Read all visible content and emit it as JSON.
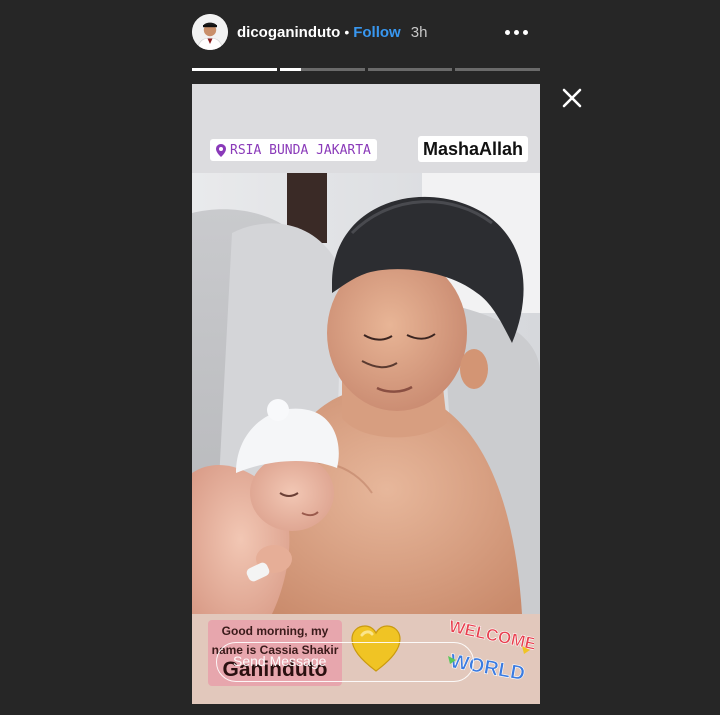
{
  "header": {
    "username": "dicoganinduto",
    "separator": "•",
    "follow_label": "Follow",
    "time": "3h"
  },
  "progress": {
    "segments": [
      1.0,
      0.25,
      0.0,
      0.0
    ]
  },
  "story": {
    "location": "RSIA BUNDA JAKARTA",
    "sticker_text": "MashaAllah",
    "caption": {
      "line1": "Good morning, my",
      "line2": "name is Cassia Shakir",
      "line3": "Ganinduto"
    },
    "welcome_sticker": {
      "word1": "WELCOME",
      "word2": "WORLD"
    }
  },
  "reply": {
    "placeholder": "Send Message"
  },
  "colors": {
    "background": "#262626",
    "follow": "#3897f0",
    "location_text": "#8a3ab9"
  },
  "icons": [
    "more-options-icon",
    "close-icon",
    "location-pin-icon",
    "heart-icon"
  ]
}
